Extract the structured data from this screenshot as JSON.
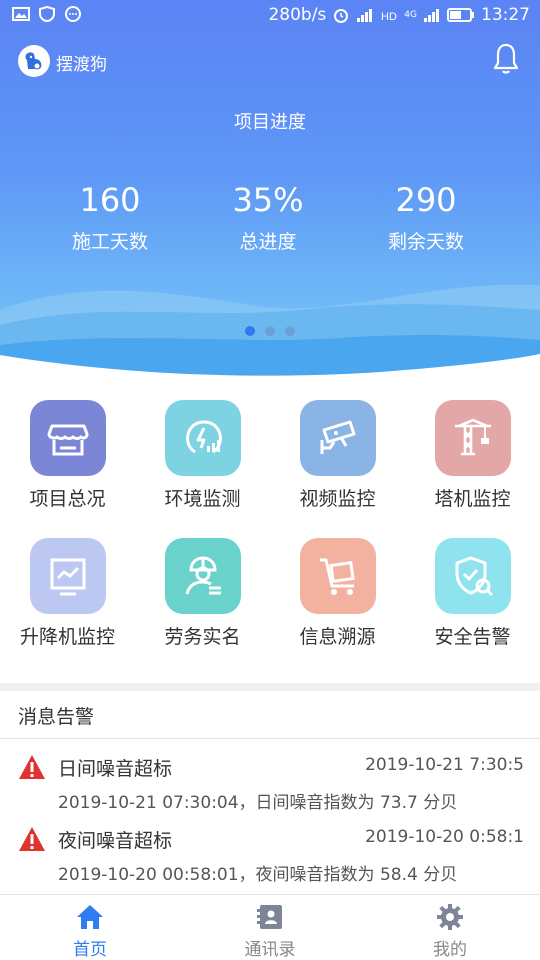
{
  "status_bar": {
    "net_speed": "280b/s",
    "network_type": "4G",
    "time": "13:27",
    "icons": [
      "image-icon",
      "shield-icon",
      "chat-icon",
      "alarm-icon",
      "signal-icon",
      "hd-icon",
      "signal-4g-icon",
      "battery-icon"
    ]
  },
  "app_bar": {
    "app_name": "摆渡狗",
    "logo_icon": "dog-logo-icon",
    "bell_icon": "bell-icon"
  },
  "hero": {
    "title": "项目进度",
    "stats": [
      {
        "value": "160",
        "label": "施工天数"
      },
      {
        "value": "35%",
        "label": "总进度"
      },
      {
        "value": "290",
        "label": "剩余天数"
      }
    ],
    "carousel": {
      "count": 3,
      "active": 0
    }
  },
  "modules": [
    {
      "label": "项目总况",
      "icon": "storefront-icon",
      "color": "#7c86d6"
    },
    {
      "label": "环境监测",
      "icon": "gauge-icon",
      "color": "#7ed3e3"
    },
    {
      "label": "视频监控",
      "icon": "cctv-camera-icon",
      "color": "#8ab4e6"
    },
    {
      "label": "塔机监控",
      "icon": "tower-crane-icon",
      "color": "#e3a7a8"
    },
    {
      "label": "升降机监控",
      "icon": "elevator-monitor-icon",
      "color": "#bcc8f2"
    },
    {
      "label": "劳务实名",
      "icon": "worker-helmet-icon",
      "color": "#68d2cb"
    },
    {
      "label": "信息溯源",
      "icon": "trolley-icon",
      "color": "#f3b2a0"
    },
    {
      "label": "安全告警",
      "icon": "shield-search-icon",
      "color": "#8fe3ee"
    }
  ],
  "messages": {
    "header": "消息告警",
    "items": [
      {
        "title": "日间噪音超标",
        "time": "2019-10-21 7:30:5",
        "body": "2019-10-21 07:30:04，日间噪音指数为 73.7 分贝"
      },
      {
        "title": "夜间噪音超标",
        "time": "2019-10-20 0:58:1",
        "body": "2019-10-20 00:58:01，夜间噪音指数为 58.4 分贝"
      }
    ]
  },
  "tabbar": {
    "tabs": [
      {
        "label": "首页",
        "icon": "home-icon",
        "active": true
      },
      {
        "label": "通讯录",
        "icon": "contacts-icon",
        "active": false
      },
      {
        "label": "我的",
        "icon": "gear-icon",
        "active": false
      }
    ]
  },
  "colors": {
    "primary": "#2f7bf0",
    "hero_top": "#5b83f4",
    "warning_red": "#e0322f"
  }
}
